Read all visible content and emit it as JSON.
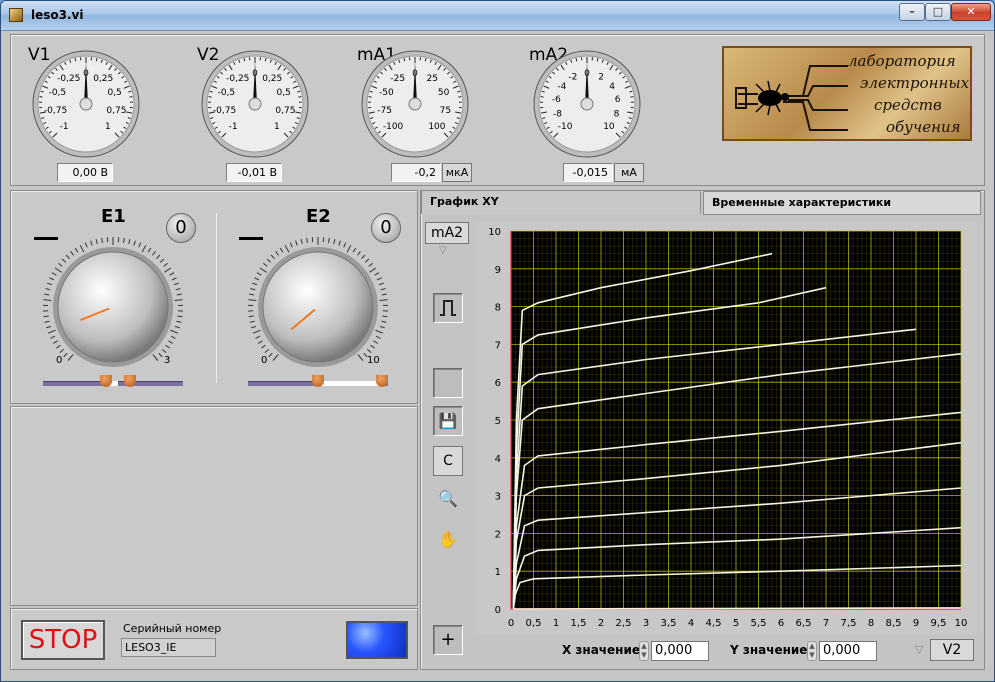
{
  "window": {
    "title": "leso3.vi"
  },
  "gauges": [
    {
      "label": "V1",
      "ticks": [
        "-0,25",
        "0,25",
        "-0,5",
        "0,5",
        "-0,75",
        "0,75",
        "-1",
        "1"
      ],
      "center": "0",
      "display": "0,00 В",
      "unit": ""
    },
    {
      "label": "V2",
      "ticks": [
        "-0,25",
        "0,25",
        "-0,5",
        "0,5",
        "-0,75",
        "0,75",
        "-1",
        "1"
      ],
      "center": "0",
      "display": "-0,01 В",
      "unit": ""
    },
    {
      "label": "mA1",
      "ticks": [
        "-25",
        "25",
        "-50",
        "50",
        "-75",
        "75",
        "-100",
        "100"
      ],
      "center": "0",
      "display": "-0,2",
      "unit": "мкА"
    },
    {
      "label": "mA2",
      "ticks": [
        "-2",
        "2",
        "-4",
        "4",
        "-6",
        "6",
        "-8",
        "8",
        "-10",
        "10"
      ],
      "center": "0",
      "display": "-0,015",
      "unit": "мА"
    }
  ],
  "logo": {
    "lines": [
      "лаборатория",
      "электронных",
      "средств",
      "обучения"
    ]
  },
  "knobs": [
    {
      "title": "E1",
      "zero": "0",
      "min": "0",
      "max": "3",
      "angle_deg": -112,
      "slider_fraction": 0.45
    },
    {
      "title": "E2",
      "zero": "0",
      "min": "0",
      "max": "10",
      "angle_deg": -130,
      "slider_fraction": 0.5
    }
  ],
  "tabs": [
    "График XY",
    "Временные характеристики"
  ],
  "toolbar": {
    "y_axis_select": "mA2",
    "x_axis_select": "V2",
    "clear_label": "C"
  },
  "cursor": {
    "x_label": "X значение",
    "x_value": "0,000",
    "y_label": "Y значение",
    "y_value": "0,000"
  },
  "stop": {
    "label": "STOP"
  },
  "serial": {
    "label": "Серийный номер",
    "value": "LESO3_IE"
  },
  "colors": {
    "plot_bg": "#000000",
    "grid": "#c8c800",
    "curve": "#f4f4e4",
    "axis_red": "#ff3030",
    "stop_text": "#e01010",
    "led": "#2a56ff"
  },
  "chart_data": {
    "type": "line",
    "xlim": [
      0,
      10
    ],
    "ylim": [
      0,
      10
    ],
    "x_ticks": [
      "0",
      "0,5",
      "1",
      "1,5",
      "2",
      "2,5",
      "3",
      "3,5",
      "4",
      "4,5",
      "5",
      "5,5",
      "6",
      "6,5",
      "7",
      "7,5",
      "8",
      "8,5",
      "9",
      "9,5",
      "10"
    ],
    "y_ticks": [
      "0",
      "1",
      "2",
      "3",
      "4",
      "5",
      "6",
      "7",
      "8",
      "9",
      "10"
    ],
    "grid": true,
    "series": [
      {
        "points": [
          [
            0.05,
            0
          ],
          [
            10,
            0.03
          ]
        ]
      },
      {
        "points": [
          [
            0.05,
            0
          ],
          [
            0.1,
            0.4
          ],
          [
            0.2,
            0.7
          ],
          [
            0.5,
            0.8
          ],
          [
            3,
            0.9
          ],
          [
            6,
            1.0
          ],
          [
            10,
            1.15
          ]
        ]
      },
      {
        "points": [
          [
            0.05,
            0
          ],
          [
            0.12,
            0.8
          ],
          [
            0.3,
            1.4
          ],
          [
            0.6,
            1.55
          ],
          [
            3,
            1.7
          ],
          [
            6,
            1.85
          ],
          [
            10,
            2.15
          ]
        ]
      },
      {
        "points": [
          [
            0.05,
            0
          ],
          [
            0.12,
            1.2
          ],
          [
            0.3,
            2.2
          ],
          [
            0.6,
            2.35
          ],
          [
            3,
            2.55
          ],
          [
            6,
            2.8
          ],
          [
            10,
            3.2
          ]
        ]
      },
      {
        "points": [
          [
            0.05,
            0
          ],
          [
            0.12,
            1.8
          ],
          [
            0.3,
            3.0
          ],
          [
            0.6,
            3.2
          ],
          [
            3,
            3.45
          ],
          [
            6,
            3.8
          ],
          [
            10,
            4.4
          ]
        ]
      },
      {
        "points": [
          [
            0.05,
            0
          ],
          [
            0.12,
            2.2
          ],
          [
            0.3,
            3.8
          ],
          [
            0.6,
            4.05
          ],
          [
            3,
            4.35
          ],
          [
            6,
            4.7
          ],
          [
            10,
            5.2
          ]
        ]
      },
      {
        "points": [
          [
            0.05,
            0
          ],
          [
            0.12,
            3.0
          ],
          [
            0.25,
            5.0
          ],
          [
            0.6,
            5.3
          ],
          [
            3,
            5.7
          ],
          [
            6,
            6.2
          ],
          [
            10,
            6.75
          ]
        ]
      },
      {
        "points": [
          [
            0.05,
            0
          ],
          [
            0.12,
            3.5
          ],
          [
            0.25,
            5.9
          ],
          [
            0.6,
            6.2
          ],
          [
            3,
            6.6
          ],
          [
            6,
            7.0
          ],
          [
            9,
            7.4
          ]
        ]
      },
      {
        "points": [
          [
            0.05,
            0
          ],
          [
            0.12,
            4.2
          ],
          [
            0.25,
            7.0
          ],
          [
            0.6,
            7.25
          ],
          [
            3,
            7.7
          ],
          [
            5.5,
            8.1
          ],
          [
            7,
            8.5
          ]
        ]
      },
      {
        "points": [
          [
            0.05,
            0
          ],
          [
            0.12,
            5.0
          ],
          [
            0.25,
            7.9
          ],
          [
            0.6,
            8.1
          ],
          [
            2,
            8.5
          ],
          [
            4,
            8.95
          ],
          [
            5.8,
            9.4
          ]
        ]
      }
    ]
  }
}
